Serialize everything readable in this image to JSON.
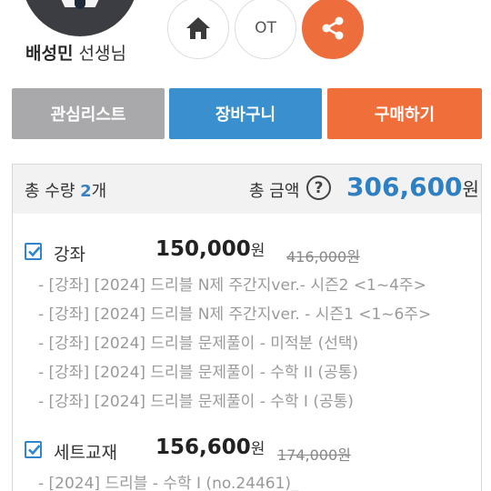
{
  "teacher": {
    "name": "배성민",
    "suffix": "선생님"
  },
  "header_buttons": {
    "ot_label": "OT"
  },
  "actions": {
    "wishlist": "관심리스트",
    "cart": "장바구니",
    "buy": "구매하기"
  },
  "colors": {
    "accent_blue": "#3a90cf",
    "accent_orange": "#ef6e3a",
    "gray_button": "#a9a9ab"
  },
  "summary": {
    "qty_label": "총 수량",
    "qty_value": "2",
    "qty_unit": "개",
    "amount_label": "총 금액",
    "help_symbol": "?",
    "amount_value": "306,600",
    "amount_unit": "원"
  },
  "groups": [
    {
      "label": "강좌",
      "price": "150,000",
      "price_unit": "원",
      "original_price": "416,000원",
      "checked": true,
      "items": [
        "- [강좌] [2024] 드리블 N제 주간지ver.- 시즌2 <1~4주>",
        "- [강좌] [2024] 드리블 N제 주간지ver. - 시즌1 <1~6주>",
        "- [강좌] [2024] 드리블 문제풀이 - 미적분 (선택)",
        "- [강좌] [2024] 드리블 문제풀이 - 수학 II (공통)",
        "- [강좌] [2024] 드리블 문제풀이 - 수학 I (공통)"
      ]
    },
    {
      "label": "세트교재",
      "price": "156,600",
      "price_unit": "원",
      "original_price": "174,000원",
      "checked": true,
      "items": [
        "- [2024] 드리블 - 수학 I  (no.24461)_"
      ]
    }
  ]
}
